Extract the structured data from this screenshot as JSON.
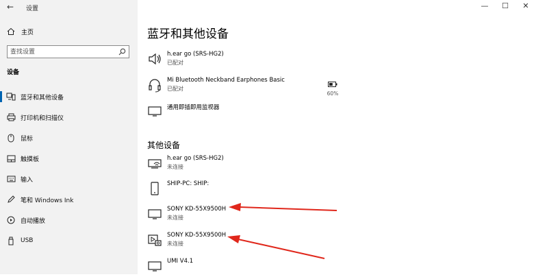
{
  "window": {
    "title": "设置",
    "back_glyph": "←",
    "minimize": "—",
    "maximize": "☐",
    "close": "✕"
  },
  "sidebar": {
    "home_label": "主页",
    "search_placeholder": "查找设置",
    "section_label": "设备",
    "items": [
      {
        "label": "蓝牙和其他设备",
        "icon": "bluetooth-devices-icon",
        "active": true
      },
      {
        "label": "打印机和扫描仪",
        "icon": "printer-icon"
      },
      {
        "label": "鼠标",
        "icon": "mouse-icon"
      },
      {
        "label": "触摸板",
        "icon": "touchpad-icon"
      },
      {
        "label": "输入",
        "icon": "keyboard-icon"
      },
      {
        "label": "笔和 Windows Ink",
        "icon": "pen-icon"
      },
      {
        "label": "自动播放",
        "icon": "autoplay-icon"
      },
      {
        "label": "USB",
        "icon": "usb-icon"
      }
    ]
  },
  "main": {
    "title": "蓝牙和其他设备",
    "audio_devices": [
      {
        "name": "h.ear go (SRS-HG2)",
        "status": "已配对",
        "icon": "speaker-icon"
      },
      {
        "name": "Mi Bluetooth Neckband Earphones Basic",
        "status": "已配对",
        "icon": "headset-icon",
        "battery": "60%",
        "battery_level": 0.6
      },
      {
        "name": "通用即插即用监视器",
        "status": "",
        "icon": "monitor-icon"
      }
    ],
    "other_title": "其他设备",
    "other_devices": [
      {
        "name": "h.ear go (SRS-HG2)",
        "status": "未连接",
        "icon": "network-device-icon"
      },
      {
        "name": "SHIP-PC: SHIP:",
        "status": "",
        "icon": "phone-icon"
      },
      {
        "name": "SONY KD-55X9500H",
        "status": "未连接",
        "icon": "monitor-icon"
      },
      {
        "name": "SONY KD-55X9500H",
        "status": "未连接",
        "icon": "media-device-icon"
      },
      {
        "name": "UMI V4.1",
        "status": "",
        "icon": "monitor-icon"
      }
    ]
  },
  "colors": {
    "accent": "#0063b1",
    "arrow": "#e0271b",
    "sidebar_bg": "#f2f2f2"
  }
}
